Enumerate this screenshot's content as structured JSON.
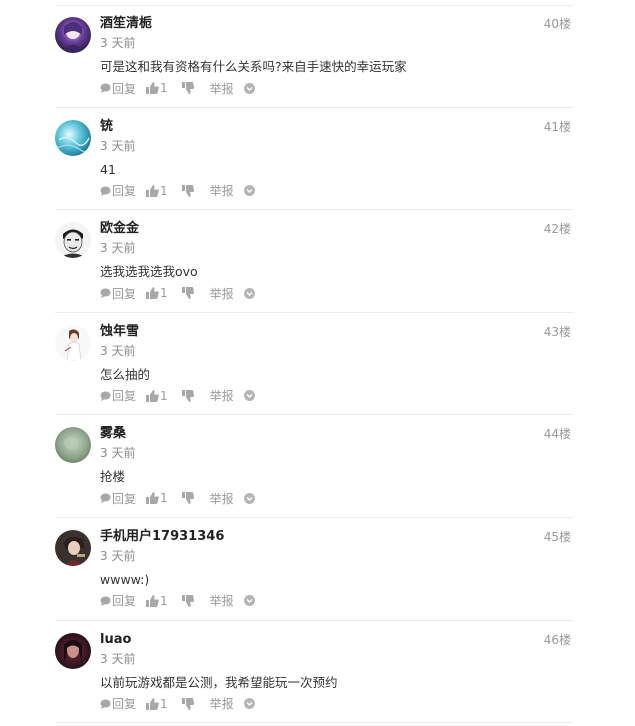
{
  "comments": [
    {
      "username": "酒笙清栀",
      "time": "3 天前",
      "text": "可是这和我有资格有什么关系吗?来自手速快的幸运玩家",
      "floor": "40楼",
      "reply_label": "回复",
      "like_count": "1",
      "report_label": "举报",
      "avatar": "avatar-purple-anime"
    },
    {
      "username": "铳",
      "time": "3 天前",
      "text": "41",
      "floor": "41楼",
      "reply_label": "回复",
      "like_count": "1",
      "report_label": "举报",
      "avatar": "avatar-blue-water"
    },
    {
      "username": "欧金金",
      "time": "3 天前",
      "text": "选我选我选我ovo",
      "floor": "42楼",
      "reply_label": "回复",
      "like_count": "1",
      "report_label": "举报",
      "avatar": "avatar-sketch-face"
    },
    {
      "username": "蚀年雪",
      "time": "3 天前",
      "text": "怎么抽的",
      "floor": "43楼",
      "reply_label": "回复",
      "like_count": "1",
      "report_label": "举报",
      "avatar": "avatar-white-figure"
    },
    {
      "username": "雾桑",
      "time": "3 天前",
      "text": "抢楼",
      "floor": "44楼",
      "reply_label": "回复",
      "like_count": "1",
      "report_label": "举报",
      "avatar": "avatar-green-blur"
    },
    {
      "username": "手机用户17931346",
      "time": "3 天前",
      "text": "wwww:)",
      "floor": "45楼",
      "reply_label": "回复",
      "like_count": "1",
      "report_label": "举报",
      "avatar": "avatar-anime-character"
    },
    {
      "username": "luao",
      "time": "3 天前",
      "text": "以前玩游戏都是公测，我希望能玩一次预约",
      "floor": "46楼",
      "reply_label": "回复",
      "like_count": "1",
      "report_label": "举报",
      "avatar": "avatar-dark-portrait"
    }
  ],
  "colors": {
    "text": "#333333",
    "muted": "#999999",
    "divider": "#ececec",
    "icon": "#a8a8a8"
  }
}
